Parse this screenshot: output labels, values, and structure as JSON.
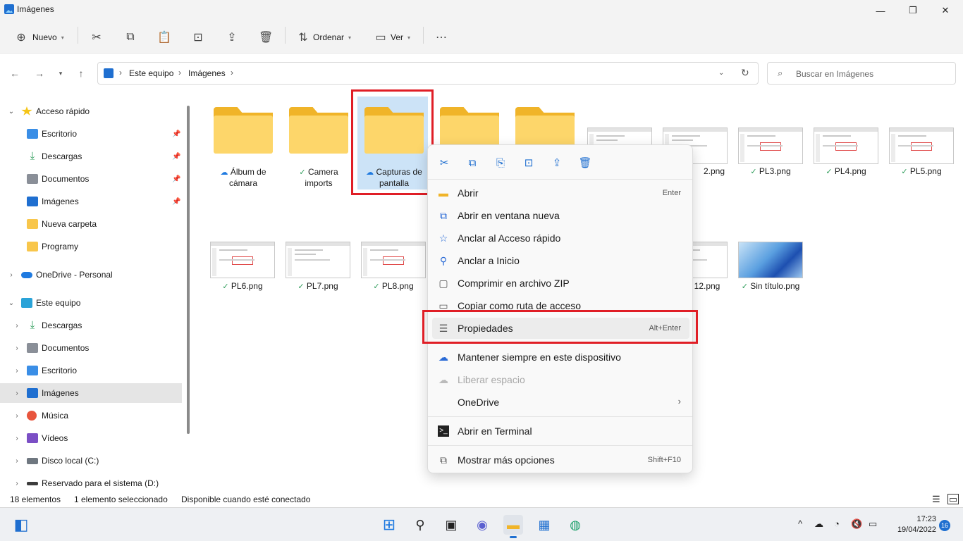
{
  "window": {
    "title": "Imágenes"
  },
  "toolbar": {
    "new_label": "Nuevo",
    "sort_label": "Ordenar",
    "view_label": "Ver"
  },
  "address": {
    "crumbs": [
      "Este equipo",
      "Imágenes"
    ],
    "search_placeholder": "Buscar en Imágenes"
  },
  "sidebar": {
    "quick_access": "Acceso rápido",
    "quick_items": [
      "Escritorio",
      "Descargas",
      "Documentos",
      "Imágenes",
      "Nueva carpeta",
      "Programy"
    ],
    "onedrive": "OneDrive - Personal",
    "this_pc": "Este equipo",
    "pc_items": [
      "Descargas",
      "Documentos",
      "Escritorio",
      "Imágenes",
      "Música",
      "Vídeos",
      "Disco local (C:)",
      "Reservado para el sistema (D:)"
    ]
  },
  "content": {
    "folders": [
      {
        "name_line1": "Álbum de",
        "name_line2": "cámara",
        "status": "cloud"
      },
      {
        "name_line1": "Camera",
        "name_line2": "imports",
        "status": "ok"
      },
      {
        "name_line1": "Capturas de",
        "name_line2": "pantalla",
        "status": "cloud"
      }
    ],
    "row1_files": [
      "2.png",
      "PL3.png",
      "PL4.png",
      "PL5.png"
    ],
    "row2_files": [
      "PL6.png",
      "PL7.png",
      "PL8.png",
      "12.png",
      "Sin título.png"
    ]
  },
  "context_menu": {
    "items": [
      {
        "label": "Abrir",
        "key": "Enter"
      },
      {
        "label": "Abrir en ventana nueva",
        "key": ""
      },
      {
        "label": "Anclar al Acceso rápido",
        "key": ""
      },
      {
        "label": "Anclar a Inicio",
        "key": ""
      },
      {
        "label": "Comprimir en archivo ZIP",
        "key": ""
      },
      {
        "label": "Copiar como ruta de acceso",
        "key": ""
      },
      {
        "label": "Propiedades",
        "key": "Alt+Enter"
      },
      {
        "label": "Mantener siempre en este dispositivo",
        "key": ""
      },
      {
        "label": "Liberar espacio",
        "key": ""
      },
      {
        "label": "OneDrive",
        "key": ""
      },
      {
        "label": "Abrir en Terminal",
        "key": ""
      },
      {
        "label": "Mostrar más opciones",
        "key": "Shift+F10"
      }
    ]
  },
  "statusbar": {
    "count": "18 elementos",
    "selected": "1 elemento seleccionado",
    "availability": "Disponible cuando esté conectado"
  },
  "taskbar": {
    "time": "17:23",
    "date": "19/04/2022",
    "notification_count": "16"
  },
  "colors": {
    "accent": "#1f6fd0",
    "highlight_box": "#e01e26",
    "folder": "#fdd66a"
  }
}
